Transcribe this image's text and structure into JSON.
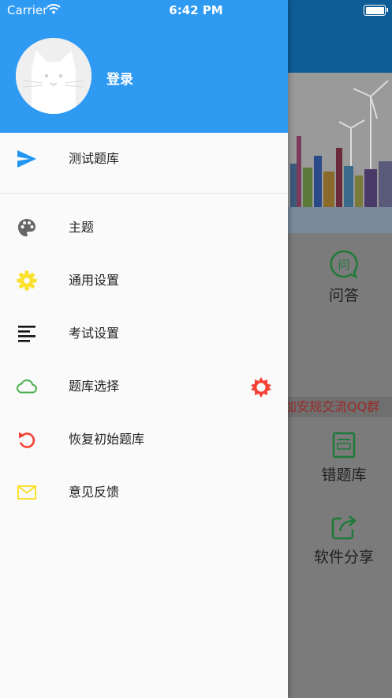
{
  "status_bar": {
    "carrier": "Carrier",
    "time": "6:42 PM"
  },
  "drawer": {
    "login_label": "登录",
    "items": [
      {
        "label": "测试题库",
        "icon": "send-icon"
      },
      {
        "label": "主题",
        "icon": "palette-icon"
      },
      {
        "label": "通用设置",
        "icon": "gear-icon"
      },
      {
        "label": "考试设置",
        "icon": "text-lines-icon"
      },
      {
        "label": "题库选择",
        "icon": "cloud-icon"
      },
      {
        "label": "恢复初始题库",
        "icon": "restore-icon"
      },
      {
        "label": "意见反馈",
        "icon": "mail-icon"
      }
    ]
  },
  "background": {
    "qa_label": "问答",
    "marquee_text": "加安规交流QQ群",
    "wrong_questions_label": "错题库",
    "share_label": "软件分享"
  },
  "colors": {
    "header_blue": "#2F9AF2",
    "icon_blue": "#2196F3",
    "icon_yellow": "#FBE12B",
    "icon_green": "#4CAF50",
    "icon_red": "#F44336"
  }
}
